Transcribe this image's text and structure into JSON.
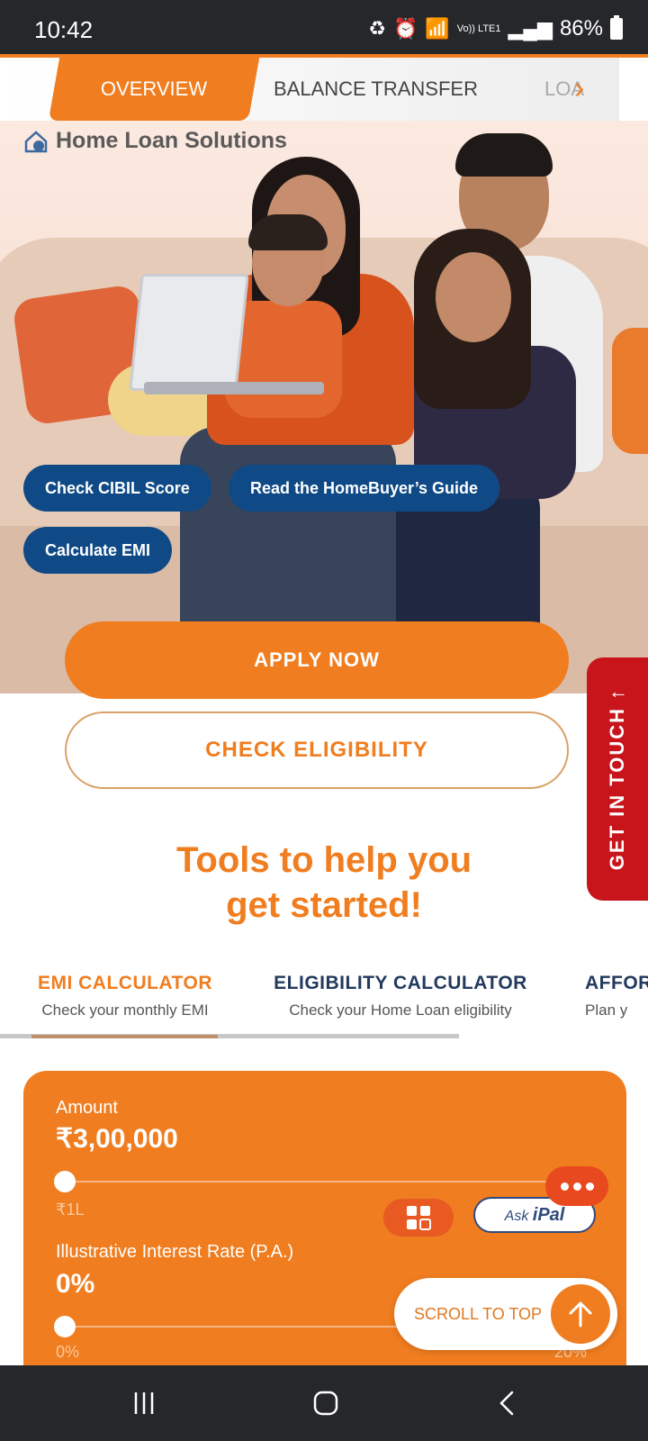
{
  "status_bar": {
    "time": "10:42",
    "network": "Vo)) LTE1",
    "battery": "86%"
  },
  "tabs": {
    "overview": "OVERVIEW",
    "balance_transfer": "BALANCE TRANSFER",
    "loan_partial": "LOA"
  },
  "hero": {
    "title": "Home Loan Solutions",
    "pills": {
      "cibil": "Check CIBIL Score",
      "guide": "Read the HomeBuyer’s Guide",
      "emi": "Calculate EMI"
    }
  },
  "actions": {
    "apply": "APPLY NOW",
    "eligibility": "CHECK ELIGIBILITY",
    "get_in_touch": "GET IN TOUCH ↑"
  },
  "tools": {
    "line1": "Tools to help you",
    "line2": "get started!"
  },
  "calc_tabs": {
    "emi": {
      "title": "EMI CALCULATOR",
      "subtitle": "Check your monthly EMI"
    },
    "eligibility": {
      "title": "ELIGIBILITY CALCULATOR",
      "subtitle": "Check your Home Loan eligibility"
    },
    "affordability": {
      "title": "AFFOR",
      "subtitle": "Plan y"
    }
  },
  "calculator": {
    "amount_label": "Amount",
    "amount_value": "₹3,00,000",
    "amount_min": "₹1L",
    "amount_slider_fraction": 0,
    "rate_label": "Illustrative Interest Rate (P.A.)",
    "rate_value": "0%",
    "rate_min": "0%",
    "rate_max": "20%",
    "rate_slider_fraction": 0
  },
  "floating": {
    "ask_prefix": "Ask",
    "ask_brand": "iPal",
    "scroll_to_top": "SCROLL TO TOP"
  },
  "colors": {
    "accent": "#f07d1f",
    "pill_blue": "#104a86",
    "get_in_touch_red": "#c8141b"
  }
}
